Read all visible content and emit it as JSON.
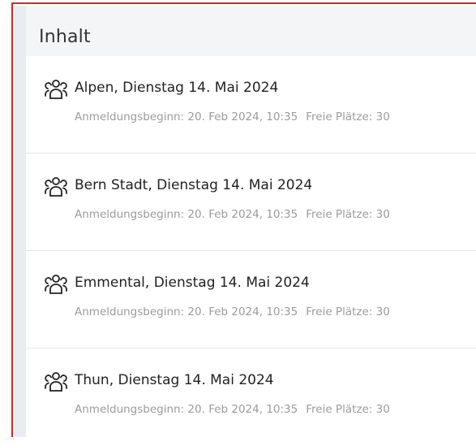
{
  "panel": {
    "title": "Inhalt"
  },
  "items": [
    {
      "icon": "group-icon",
      "title": "Alpen, Dienstag 14. Mai 2024",
      "registration_start": "Anmeldungsbeginn: 20. Feb 2024, 10:35",
      "free_seats": "Freie Plätze: 30"
    },
    {
      "icon": "group-icon",
      "title": "Bern Stadt, Dienstag 14. Mai 2024",
      "registration_start": "Anmeldungsbeginn: 20. Feb 2024, 10:35",
      "free_seats": "Freie Plätze: 30"
    },
    {
      "icon": "group-icon",
      "title": "Emmental, Dienstag 14. Mai 2024",
      "registration_start": "Anmeldungsbeginn: 20. Feb 2024, 10:35",
      "free_seats": "Freie Plätze: 30"
    },
    {
      "icon": "group-icon",
      "title": "Thun, Dienstag 14. Mai 2024",
      "registration_start": "Anmeldungsbeginn: 20. Feb 2024, 10:35",
      "free_seats": "Freie Plätze: 30"
    }
  ],
  "colors": {
    "focus_border": "#e0241b",
    "header_bg": "#f3f5f7",
    "meta_text": "#9b9b9b"
  }
}
